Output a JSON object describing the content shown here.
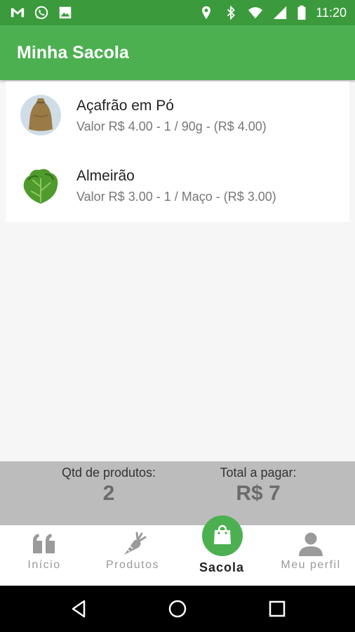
{
  "status_bar": {
    "time": "11:20",
    "left_icons": [
      "gmail-icon",
      "whatsapp-icon",
      "image-icon"
    ],
    "right_icons": [
      "location-icon",
      "bluetooth-icon",
      "wifi-icon",
      "signal-icon",
      "battery-icon"
    ]
  },
  "app_bar": {
    "title": "Minha Sacola"
  },
  "cart": {
    "items": [
      {
        "name": "Açafrão em Pó",
        "details": "Valor R$ 4.00 - 1 / 90g - (R$ 4.00)",
        "image_icon": "saffron-bag-icon"
      },
      {
        "name": "Almeirão",
        "details": "Valor R$ 3.00 - 1 / Maço - (R$ 3.00)",
        "image_icon": "chicory-leaf-icon"
      }
    ]
  },
  "summary": {
    "qty_label": "Qtd de produtos:",
    "qty_value": "2",
    "total_label": "Total a pagar:",
    "total_value": "R$ 7"
  },
  "bottom_nav": {
    "items": [
      {
        "label": "Início",
        "icon": "quote-icon",
        "active": false
      },
      {
        "label": "Produtos",
        "icon": "carrot-icon",
        "active": false
      },
      {
        "label": "Sacola",
        "icon": "shopping-bag-icon",
        "active": true
      },
      {
        "label": "Meu perfil",
        "icon": "person-icon",
        "active": false
      }
    ]
  },
  "system_nav": {
    "icons": [
      "back-icon",
      "home-icon",
      "recents-icon"
    ]
  },
  "colors": {
    "status_bar": "#3a9a3c",
    "app_bar": "#4cb050",
    "accent": "#4cb050",
    "summary_bg": "#bcbcbc"
  }
}
